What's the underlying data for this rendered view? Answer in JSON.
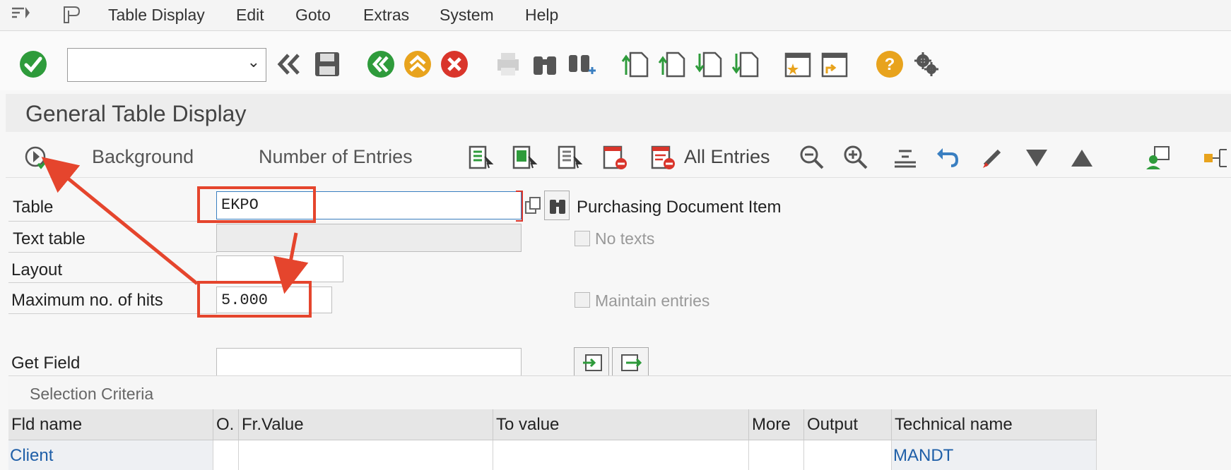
{
  "menu": {
    "items": [
      "Table Display",
      "Edit",
      "Goto",
      "Extras",
      "System",
      "Help"
    ]
  },
  "toolbar": {
    "command_field": ""
  },
  "title": "General Table Display",
  "app_toolbar": {
    "background_label": "Background",
    "num_entries_label": "Number of Entries",
    "all_entries_label": "All Entries"
  },
  "form": {
    "table_label": "Table",
    "table_value": "EKPO",
    "table_desc": "Purchasing Document Item",
    "text_table_label": "Text table",
    "text_table_value": "",
    "no_texts_label": "No texts",
    "layout_label": "Layout",
    "layout_value": "",
    "max_hits_label": "Maximum no. of hits",
    "max_hits_value": "5.000",
    "maintain_entries_label": "Maintain entries",
    "get_field_label": "Get Field",
    "get_field_value": ""
  },
  "selection": {
    "caption": "Selection Criteria",
    "headers": [
      "Fld name",
      "O.",
      "Fr.Value",
      "To value",
      "More",
      "Output",
      "Technical name"
    ],
    "rows": [
      [
        "Client",
        "",
        "",
        "",
        "",
        "",
        "MANDT"
      ]
    ]
  },
  "colors": {
    "accent_green": "#2e9b3b",
    "accent_orange": "#e8a31d",
    "accent_red": "#d9352b",
    "annotation_red": "#e5452d",
    "link_blue": "#1f5fa8"
  }
}
